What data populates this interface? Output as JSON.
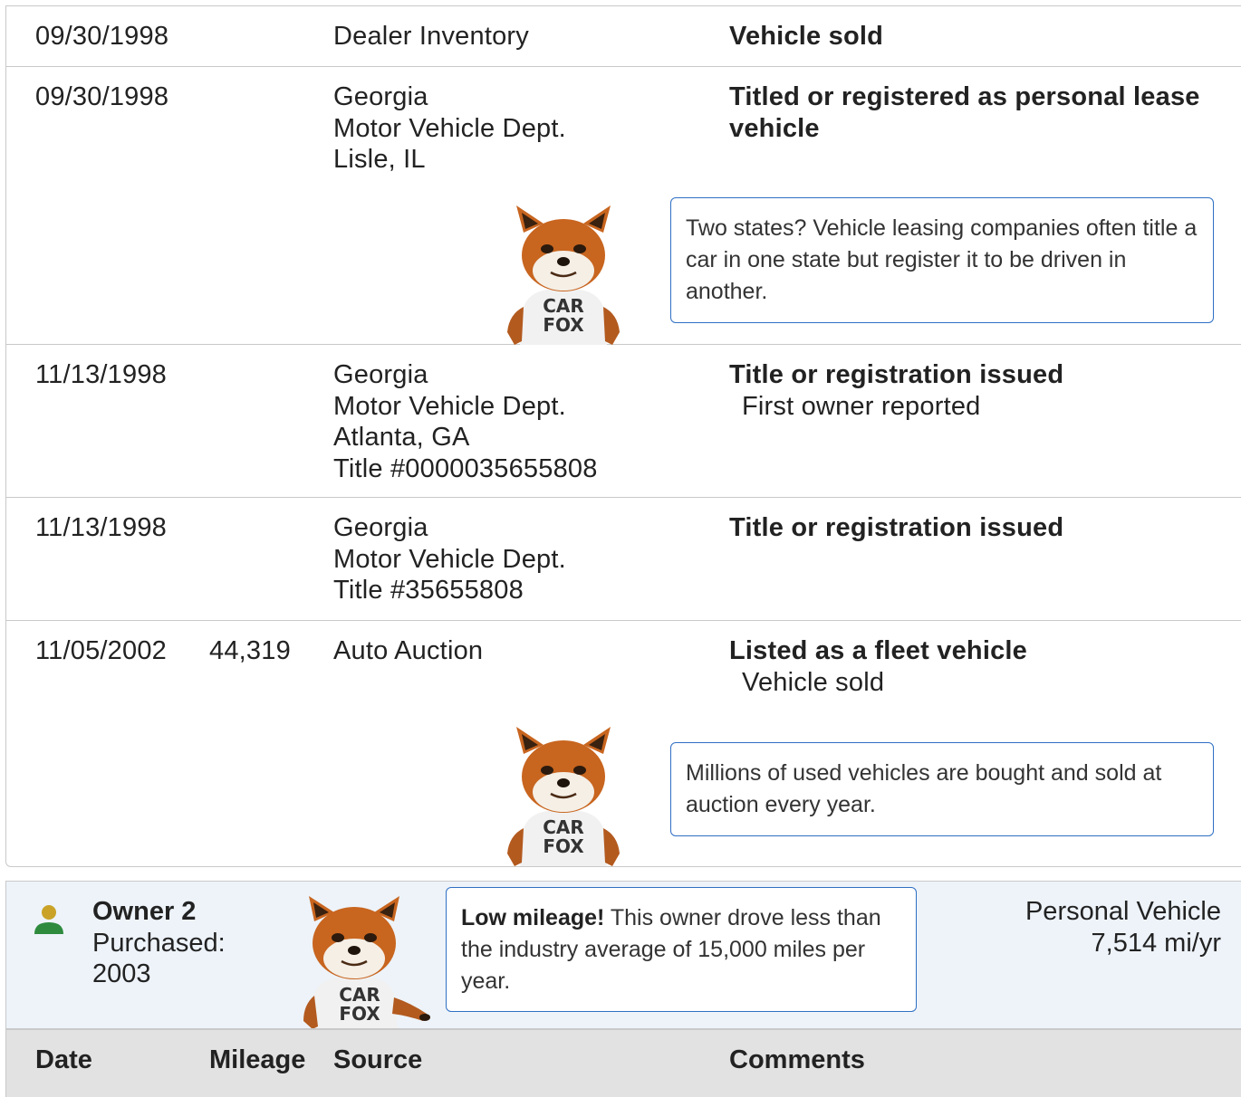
{
  "records": [
    {
      "date": "09/30/1998",
      "mileage": "",
      "source": [
        "Dealer Inventory"
      ],
      "comment_head": "Vehicle sold",
      "comment_sub": ""
    },
    {
      "date": "09/30/1998",
      "mileage": "",
      "source": [
        "Georgia",
        "Motor Vehicle Dept.",
        "Lisle, IL"
      ],
      "comment_head": "Titled or registered as personal lease vehicle",
      "comment_sub": "",
      "tip": "Two states? Vehicle leasing companies often title a car in one state but register it to be driven in another."
    },
    {
      "date": "11/13/1998",
      "mileage": "",
      "source": [
        "Georgia",
        "Motor Vehicle Dept.",
        "Atlanta, GA",
        "Title #0000035655808"
      ],
      "comment_head": "Title or registration issued",
      "comment_sub": "First owner reported"
    },
    {
      "date": "11/13/1998",
      "mileage": "",
      "source": [
        "Georgia",
        "Motor Vehicle Dept.",
        "Title #35655808"
      ],
      "comment_head": "Title or registration issued",
      "comment_sub": ""
    },
    {
      "date": "11/05/2002",
      "mileage": "44,319",
      "source": [
        "Auto Auction"
      ],
      "comment_head": "Listed as a fleet vehicle",
      "comment_sub": "Vehicle sold",
      "tip": "Millions of used vehicles are bought and sold at auction every year."
    }
  ],
  "owner": {
    "title": "Owner 2",
    "purchased_label": "Purchased:",
    "purchased_year": "2003",
    "tip_bold": "Low mileage!",
    "tip_text": " This owner drove less than the industry average of 15,000 miles per year.",
    "type": "Personal Vehicle",
    "miles_per_year": "7,514 mi/yr",
    "icon": "person-icon",
    "icon_colors": {
      "head": "#c9a227",
      "body": "#2e8b3e"
    }
  },
  "table_header": {
    "date": "Date",
    "mileage": "Mileage",
    "source": "Source",
    "comments": "Comments"
  },
  "mascot": {
    "shirt_text_1": "CAR",
    "shirt_text_2": "FOX"
  },
  "colors": {
    "tip_border": "#2f6fc4",
    "owner_bg": "#edf3f9",
    "header_bg": "#e2e2e2",
    "divider": "#c9c9c9"
  }
}
